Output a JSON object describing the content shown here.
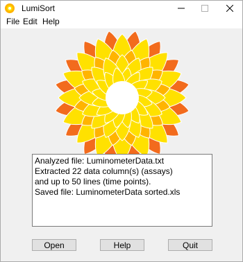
{
  "window": {
    "title": "LumiSort"
  },
  "menu": {
    "items": [
      "File",
      "Edit",
      "Help"
    ]
  },
  "log": {
    "lines": [
      "Analyzed file: LuminometerData.txt",
      "Extracted 22 data column(s) (assays)",
      "and up to 50 lines (time points).",
      "Saved file: LuminometerData sorted.xls"
    ]
  },
  "buttons": {
    "open": "Open",
    "help": "Help",
    "quit": "Quit"
  },
  "icons": {
    "app": "sun-flower-icon",
    "minimize": "minimize-icon",
    "maximize": "maximize-icon",
    "close": "close-icon"
  },
  "colors": {
    "petal_outer": "#f26b1d",
    "petal_mid": "#ffb400",
    "petal_inner": "#ffe100",
    "center": "#ffffff"
  }
}
